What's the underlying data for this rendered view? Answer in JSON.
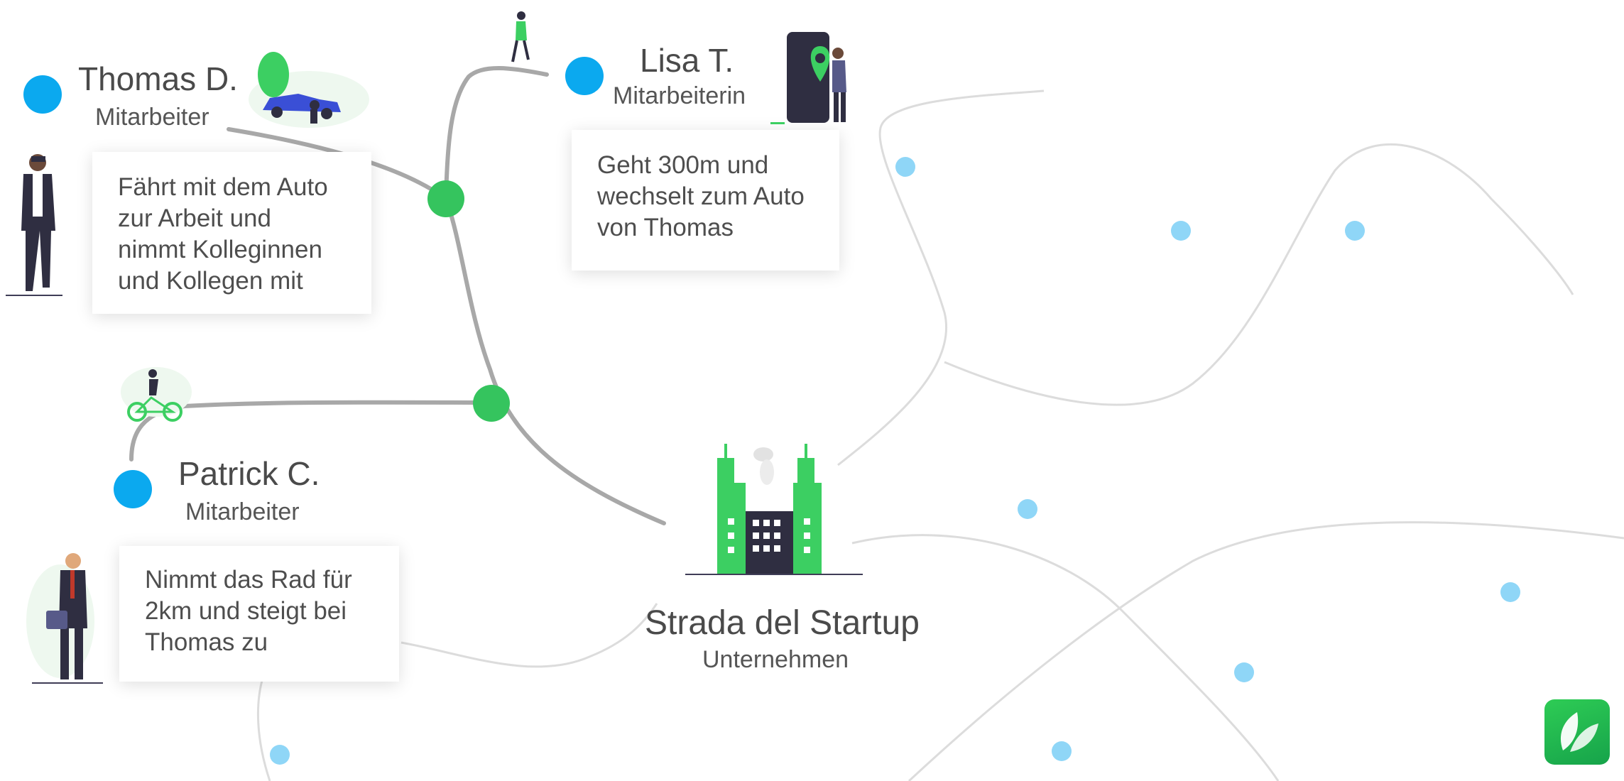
{
  "people": [
    {
      "name": "Thomas D.",
      "role": "Mitarbeiter",
      "description": [
        "Fährt mit dem Auto",
        "zur Arbeit und",
        "nimmt Kolleginnen",
        "und Kollegen mit"
      ]
    },
    {
      "name": "Lisa T.",
      "role": "Mitarbeiterin",
      "description": [
        "Geht 300m und",
        "wechselt zum Auto",
        "von Thomas"
      ]
    },
    {
      "name": "Patrick C.",
      "role": "Mitarbeiter",
      "description": [
        "Nimmt das Rad für",
        "2km und steigt bei",
        "Thomas zu"
      ]
    }
  ],
  "company": {
    "name": "Strada del Startup",
    "role": "Unternehmen"
  },
  "colors": {
    "person_dot": "#0ba9ef",
    "junction": "#35c45e",
    "route": "#a8a8a8",
    "background_road": "#dcdcdc",
    "light_dot": "#8fd6f7",
    "accent_green": "#3ccf62"
  },
  "icons": {
    "logo": "leaf-logo-icon"
  }
}
